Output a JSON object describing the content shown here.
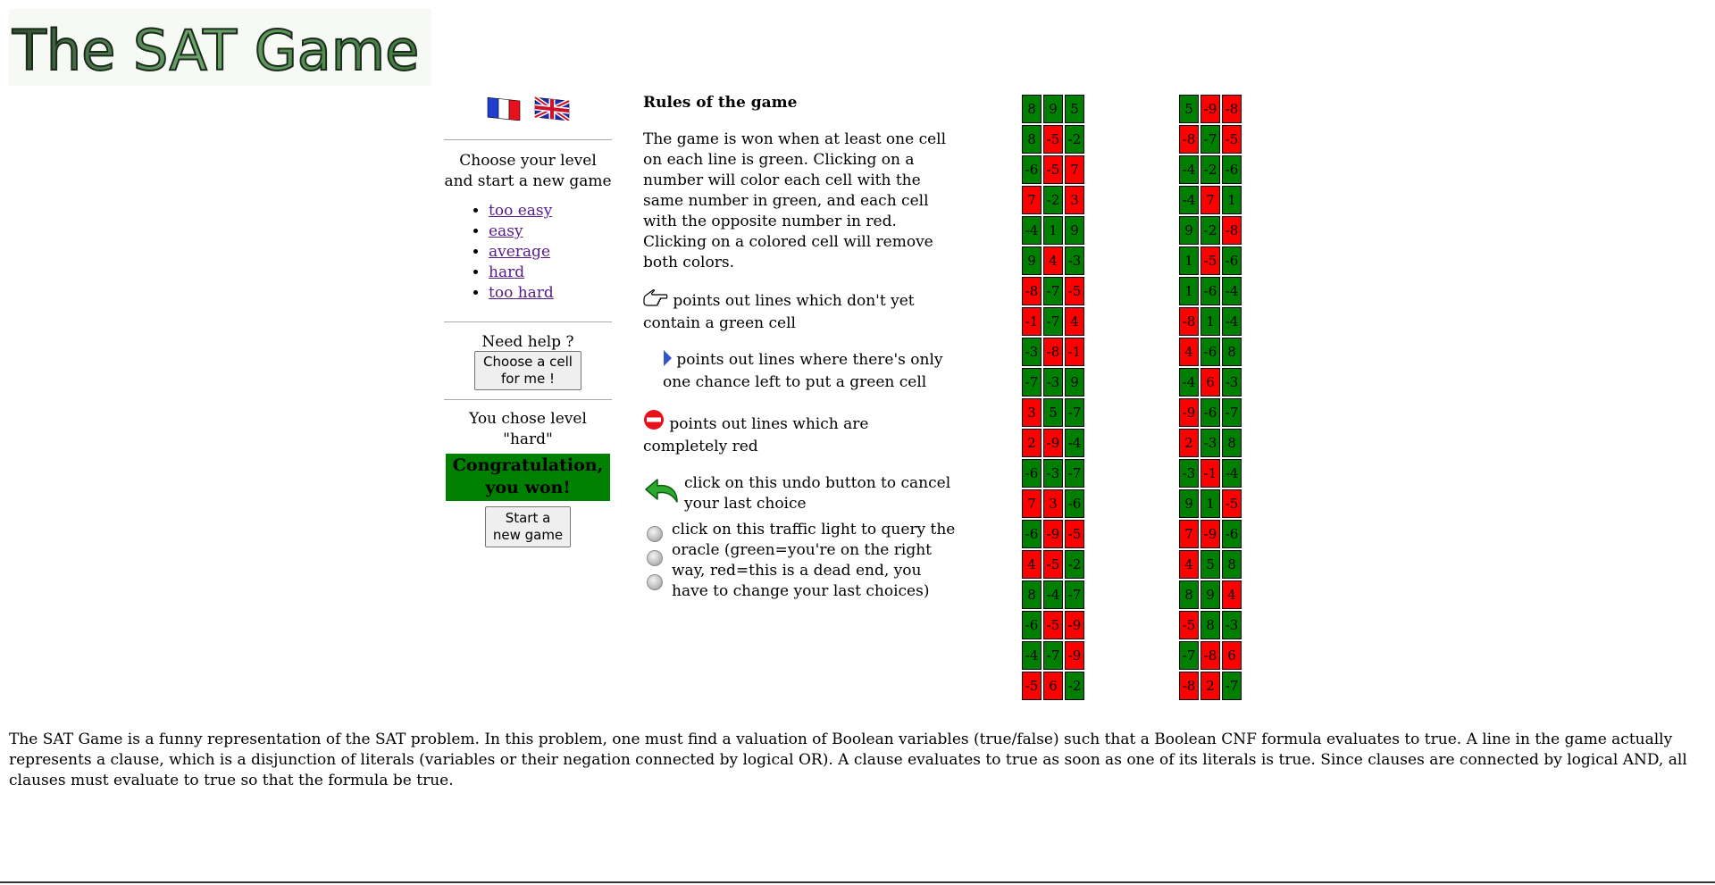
{
  "header": {
    "logo_text": "The SAT Game"
  },
  "languages": [
    {
      "name": "french-flag"
    },
    {
      "name": "uk-flag"
    }
  ],
  "level_panel": {
    "intro": "Choose your level and start a new game",
    "levels": [
      "too easy",
      "easy",
      "average",
      "hard",
      "too hard"
    ]
  },
  "help": {
    "title": "Need help ?",
    "button_line1": "Choose a cell",
    "button_line2": "for me !"
  },
  "status": {
    "chosen_line1": "You chose level",
    "chosen_line2": "\"hard\"",
    "win_line1": "Congratulation,",
    "win_line2": "you won!",
    "new_game_line1": "Start a",
    "new_game_line2": "new game"
  },
  "rules": {
    "title": "Rules of the game",
    "text": "The game is won when at least one cell on each line is green. Clicking on a number will color each cell with the same number in green, and each cell with the opposite number in red. Clicking on a colored cell will remove both colors.",
    "hand": "points out lines which don't yet contain a green cell",
    "arrow": "points out lines where there's only one chance left to put a green cell",
    "stop": "points out lines which are completely red",
    "undo": "click on this undo button to cancel your last choice",
    "oracle": "click on this traffic light to query the oracle (green=you're on the right way, red=this is a dead end, you have to change your last choices)"
  },
  "icons": {
    "hand": "pointing-hand-icon",
    "arrow": "blue-arrow-icon",
    "stop": "no-entry-icon",
    "undo": "undo-arrow-icon",
    "light": "traffic-light-icon"
  },
  "colors": {
    "green": "#008000",
    "red": "#ff0000",
    "link": "#551a8b"
  },
  "grids": [
    [
      [
        [
          "8",
          "g"
        ],
        [
          "9",
          "g"
        ],
        [
          "5",
          "g"
        ]
      ],
      [
        [
          "8",
          "g"
        ],
        [
          "-5",
          "r"
        ],
        [
          "-2",
          "g"
        ]
      ],
      [
        [
          "-6",
          "g"
        ],
        [
          "-5",
          "r"
        ],
        [
          "7",
          "r"
        ]
      ],
      [
        [
          "7",
          "r"
        ],
        [
          "-2",
          "g"
        ],
        [
          "3",
          "r"
        ]
      ],
      [
        [
          "-4",
          "g"
        ],
        [
          "1",
          "g"
        ],
        [
          "9",
          "g"
        ]
      ],
      [
        [
          "9",
          "g"
        ],
        [
          "4",
          "r"
        ],
        [
          "-3",
          "g"
        ]
      ],
      [
        [
          "-8",
          "r"
        ],
        [
          "-7",
          "g"
        ],
        [
          "-5",
          "r"
        ]
      ],
      [
        [
          "-1",
          "r"
        ],
        [
          "-7",
          "g"
        ],
        [
          "4",
          "r"
        ]
      ],
      [
        [
          "-3",
          "g"
        ],
        [
          "-8",
          "r"
        ],
        [
          "-1",
          "r"
        ]
      ],
      [
        [
          "-7",
          "g"
        ],
        [
          "-3",
          "g"
        ],
        [
          "9",
          "g"
        ]
      ],
      [
        [
          "3",
          "r"
        ],
        [
          "5",
          "g"
        ],
        [
          "-7",
          "g"
        ]
      ],
      [
        [
          "2",
          "r"
        ],
        [
          "-9",
          "r"
        ],
        [
          "-4",
          "g"
        ]
      ],
      [
        [
          "-6",
          "g"
        ],
        [
          "-3",
          "g"
        ],
        [
          "-7",
          "g"
        ]
      ],
      [
        [
          "7",
          "r"
        ],
        [
          "3",
          "r"
        ],
        [
          "-6",
          "g"
        ]
      ],
      [
        [
          "-6",
          "g"
        ],
        [
          "-9",
          "r"
        ],
        [
          "-5",
          "r"
        ]
      ],
      [
        [
          "4",
          "r"
        ],
        [
          "-5",
          "r"
        ],
        [
          "-2",
          "g"
        ]
      ],
      [
        [
          "8",
          "g"
        ],
        [
          "-4",
          "g"
        ],
        [
          "-7",
          "g"
        ]
      ],
      [
        [
          "-6",
          "g"
        ],
        [
          "-5",
          "r"
        ],
        [
          "-9",
          "r"
        ]
      ],
      [
        [
          "-4",
          "g"
        ],
        [
          "-7",
          "g"
        ],
        [
          "-9",
          "r"
        ]
      ],
      [
        [
          "-5",
          "r"
        ],
        [
          "6",
          "r"
        ],
        [
          "-2",
          "g"
        ]
      ]
    ],
    [
      [
        [
          "5",
          "g"
        ],
        [
          "-9",
          "r"
        ],
        [
          "-8",
          "r"
        ]
      ],
      [
        [
          "-8",
          "r"
        ],
        [
          "-7",
          "g"
        ],
        [
          "-5",
          "r"
        ]
      ],
      [
        [
          "-4",
          "g"
        ],
        [
          "-2",
          "g"
        ],
        [
          "-6",
          "g"
        ]
      ],
      [
        [
          "-4",
          "g"
        ],
        [
          "7",
          "r"
        ],
        [
          "1",
          "g"
        ]
      ],
      [
        [
          "9",
          "g"
        ],
        [
          "-2",
          "g"
        ],
        [
          "-8",
          "r"
        ]
      ],
      [
        [
          "1",
          "g"
        ],
        [
          "-5",
          "r"
        ],
        [
          "-6",
          "g"
        ]
      ],
      [
        [
          "1",
          "g"
        ],
        [
          "-6",
          "g"
        ],
        [
          "-4",
          "g"
        ]
      ],
      [
        [
          "-8",
          "r"
        ],
        [
          "1",
          "g"
        ],
        [
          "-4",
          "g"
        ]
      ],
      [
        [
          "4",
          "r"
        ],
        [
          "-6",
          "g"
        ],
        [
          "8",
          "g"
        ]
      ],
      [
        [
          "-4",
          "g"
        ],
        [
          "6",
          "r"
        ],
        [
          "-3",
          "g"
        ]
      ],
      [
        [
          "-9",
          "r"
        ],
        [
          "-6",
          "g"
        ],
        [
          "-7",
          "g"
        ]
      ],
      [
        [
          "2",
          "r"
        ],
        [
          "-3",
          "g"
        ],
        [
          "8",
          "g"
        ]
      ],
      [
        [
          "-3",
          "g"
        ],
        [
          "-1",
          "r"
        ],
        [
          "-4",
          "g"
        ]
      ],
      [
        [
          "9",
          "g"
        ],
        [
          "1",
          "g"
        ],
        [
          "-5",
          "r"
        ]
      ],
      [
        [
          "7",
          "r"
        ],
        [
          "-9",
          "r"
        ],
        [
          "-6",
          "g"
        ]
      ],
      [
        [
          "4",
          "r"
        ],
        [
          "5",
          "g"
        ],
        [
          "8",
          "g"
        ]
      ],
      [
        [
          "8",
          "g"
        ],
        [
          "9",
          "g"
        ],
        [
          "4",
          "r"
        ]
      ],
      [
        [
          "-5",
          "r"
        ],
        [
          "8",
          "g"
        ],
        [
          "-3",
          "g"
        ]
      ],
      [
        [
          "-7",
          "g"
        ],
        [
          "-8",
          "r"
        ],
        [
          "6",
          "r"
        ]
      ],
      [
        [
          "-8",
          "r"
        ],
        [
          "2",
          "r"
        ],
        [
          "-7",
          "g"
        ]
      ]
    ]
  ],
  "footer": {
    "description": "The SAT Game is a funny representation of the SAT problem. In this problem, one must find a valuation of Boolean variables (true/false) such that a Boolean CNF formula evaluates to true. A line in the game actually represents a clause, which is a disjunction of literals (variables or their negation connected by logical OR). A clause evaluates to true as soon as one of its literals is true. Since clauses are connected by logical AND, all clauses must evaluate to true so that the formula be true."
  }
}
